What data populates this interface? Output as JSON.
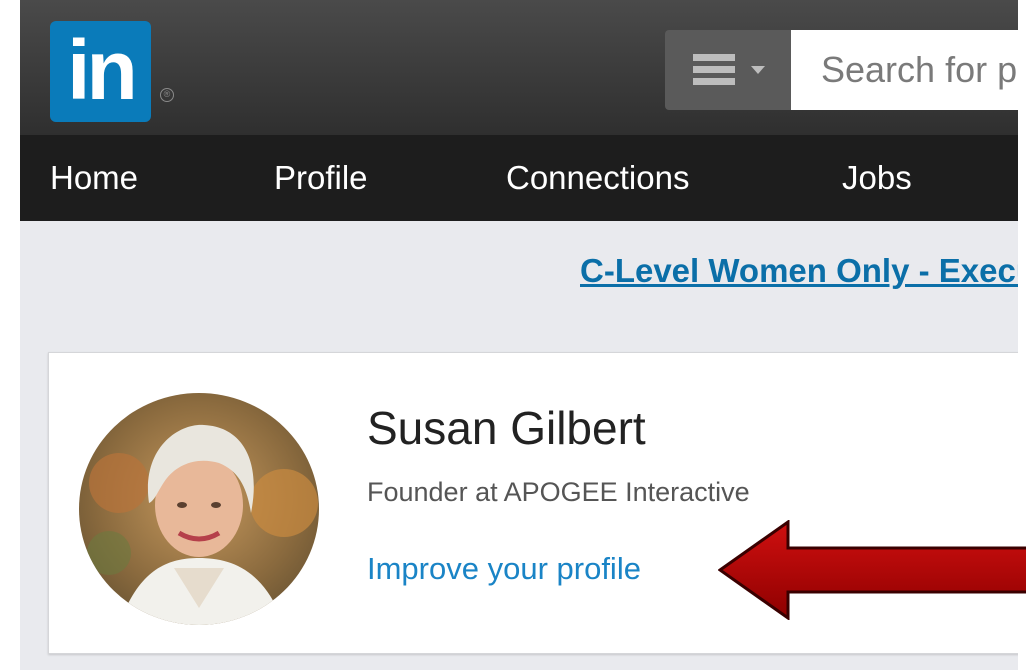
{
  "header": {
    "logo_text": "in",
    "registered_mark": "®",
    "search": {
      "category_icon": "menu-icon",
      "placeholder": "Search for people, jobs, companies, and more..."
    }
  },
  "nav": {
    "items": [
      {
        "label": "Home"
      },
      {
        "label": "Profile"
      },
      {
        "label": "Connections"
      },
      {
        "label": "Jobs"
      }
    ]
  },
  "promo": {
    "link_text": "C-Level Women Only - Executive Network"
  },
  "profile_card": {
    "name": "Susan Gilbert",
    "headline": "Founder at APOGEE Interactive",
    "improve_link": "Improve your profile"
  },
  "annotation": {
    "arrow_color": "#b30000"
  },
  "colors": {
    "brand_blue": "#0a7bba",
    "link_blue": "#1a84c6",
    "nav_bg": "#1d1d1d",
    "topbar_bg": "#3a3a3a"
  }
}
